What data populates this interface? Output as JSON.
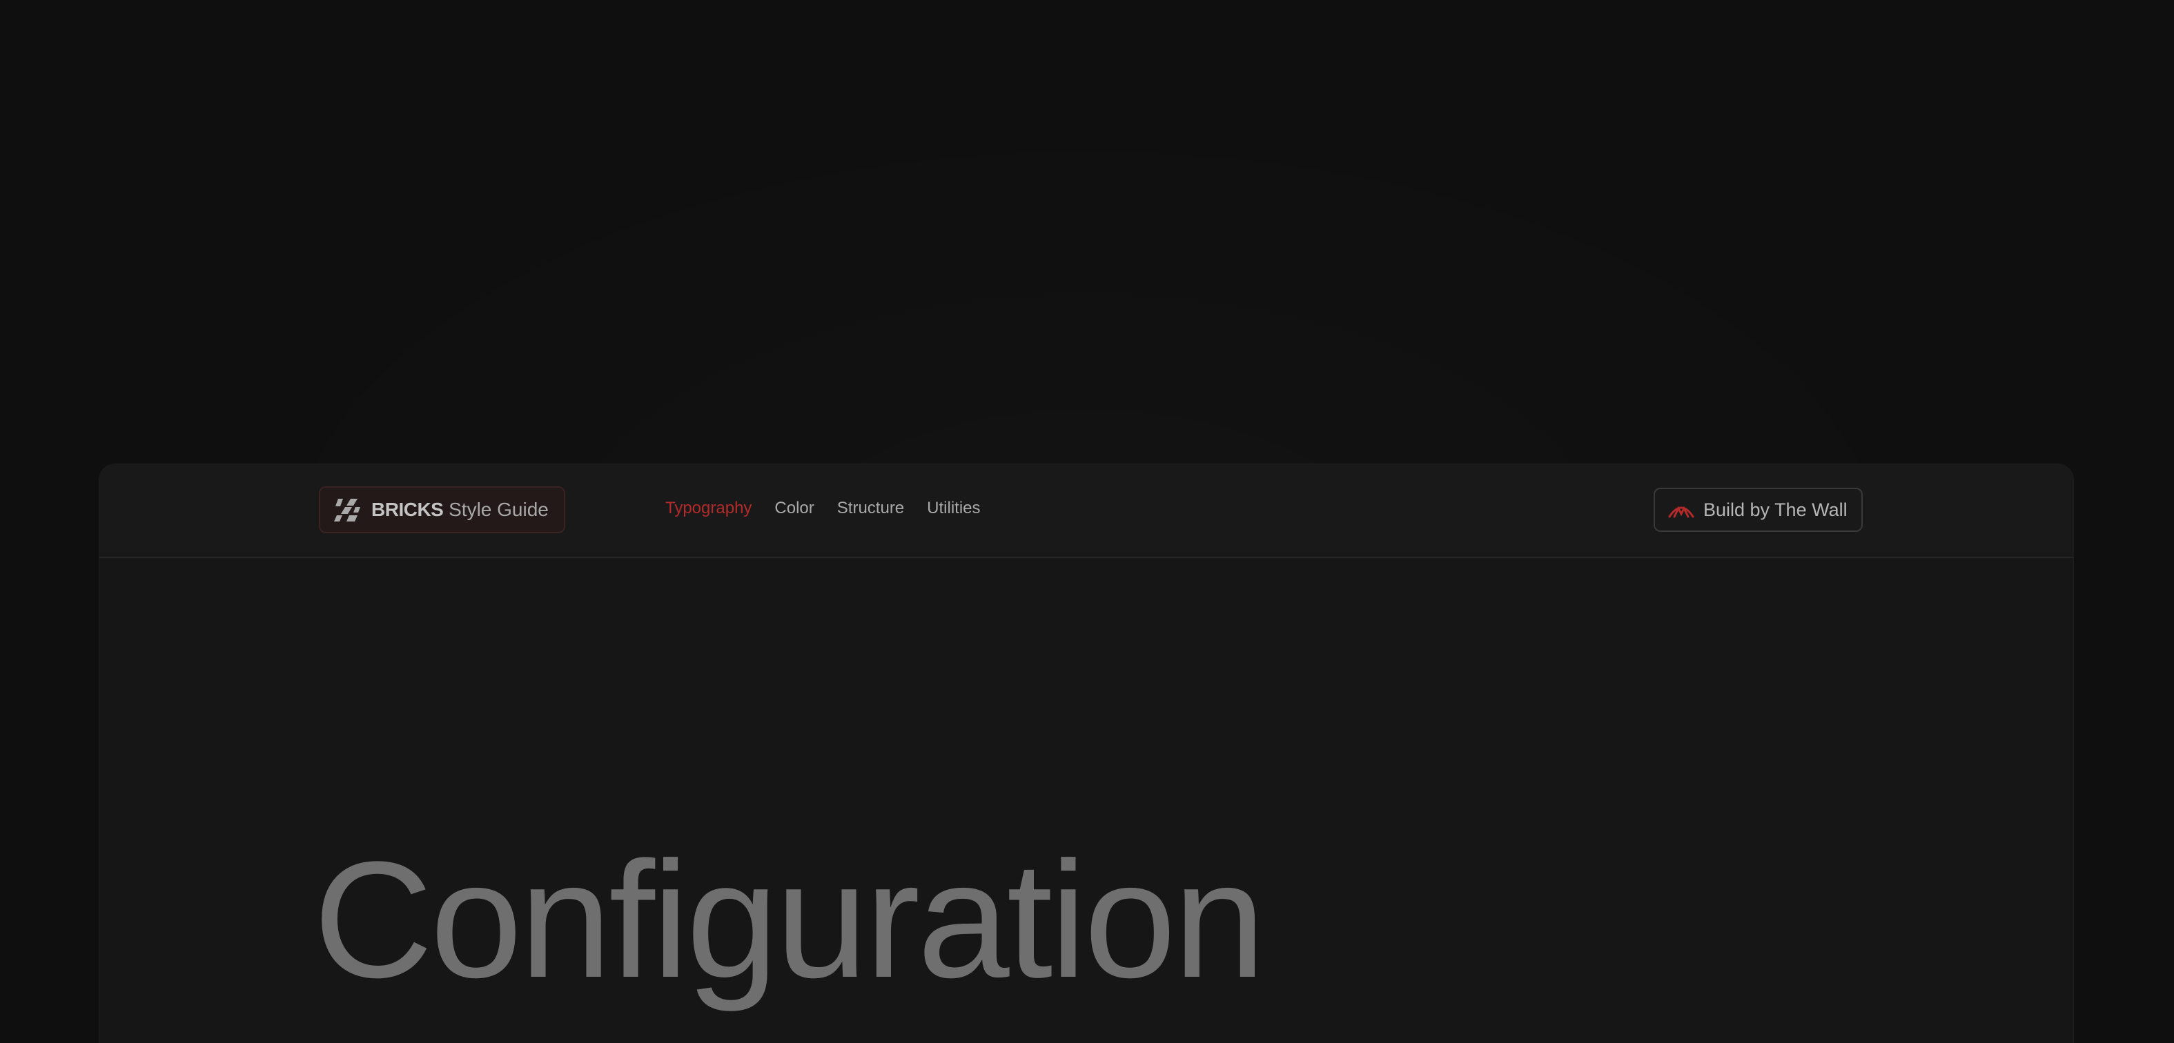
{
  "navbar": {
    "brand": {
      "icon": "bricks-logo-icon",
      "name_bold": "BRICKS",
      "name_light": "Style Guide"
    },
    "links": [
      {
        "label": "Typography",
        "active": true
      },
      {
        "label": "Color",
        "active": false
      },
      {
        "label": "Structure",
        "active": false
      },
      {
        "label": "Utilities",
        "active": false
      }
    ],
    "cta": {
      "icon": "wall-logo-icon",
      "label": "Build by The Wall"
    }
  },
  "hero": {
    "title": "Configuration"
  },
  "colors": {
    "accent": "#b32a2a",
    "background": "#0f0f0f",
    "panel": "#161616"
  }
}
